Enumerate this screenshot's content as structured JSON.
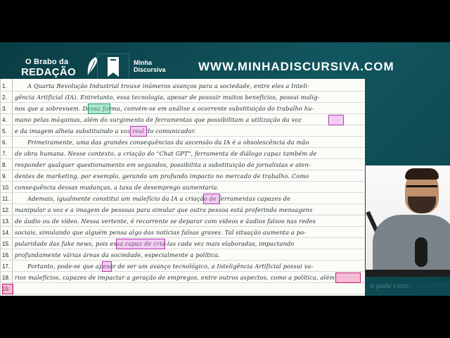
{
  "header": {
    "brand_line1": "O Brabo da",
    "brand_line2": "REDAÇÃO",
    "logo_line1": "Minha",
    "logo_line2": "Discursiva",
    "url": "WWW.MINHADISCURSIVA.COM"
  },
  "essay": {
    "line_numbers": [
      "1.",
      "2.",
      "3.",
      "4.",
      "5.",
      "6.",
      "7.",
      "8.",
      "9.",
      "10.",
      "11.",
      "12.",
      "13.",
      "14.",
      "15.",
      "16.",
      "17.",
      "18.",
      "19."
    ],
    "lines": [
      "A Quarta Revolução Industrial trouxe inúmeros avanços para a sociedade, entre eles a Inteli-",
      "gência Artificial (IA). Entretanto, essa tecnologia, apesar de possuir muitos benefícios, possui malig-",
      "nos que a sobrevuem. Dessa forma, convém-se em análise a ocorrente substituição do trabalho hu-",
      "mano pelas máquinas, além do surgimento de ferramentas que possibilitam a utilização da voz",
      "e da imagem alheia substituindo a voz real do comunicador.",
      "Primeiramente, uma das grandes consequências da ascensão da IA é a obsolescência da mão",
      "de obra humana. Nesse contexto, a criação do \"Chat GPT\", ferramenta de diálogo capaz também de",
      "responder qualquer questionamento em segundos, possibilita a substituição de jornalistas e aten-",
      "dentes de marketing, por exemplo, gerando um profundo impacto no mercado de trabalho. Como",
      "consequência dessas mudanças, a taxa de desemprego aumentaria.",
      "Ademais, igualmente constitui um malefício da IA a criação de ferramentas capazes de",
      "manipular a voz e a imagem de pessoas para simular que outra pessoa está proferindo mensagens",
      "de áudio ou de vídeo. Nessa vertente, é recorrente se deparar com vídeos e áudios falsos nas redes",
      "sociais, simulando que alguém pensa algo das notícias falsas graves. Tal situação aumenta a po-",
      "pularidade das fake news, pois essa capaz de criá-las cada vez mais elaboradas, impactando",
      "profundamente várias áreas da sociedade, especialmente a política.",
      "Portanto, pode-se que apesar de ser um avanço tecnológico, a Inteligência Artificial possui va-",
      "rios malefícios, capazes de impactar a geração de empregos, entre outros aspectos, como a política, além",
      ""
    ]
  },
  "webcam": {
    "overflow_text": "o  pode  cvno."
  }
}
